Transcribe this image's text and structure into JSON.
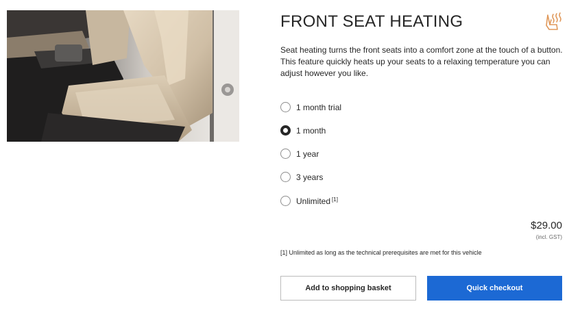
{
  "product": {
    "title": "FRONT SEAT HEATING",
    "icon": "seat-heating-icon",
    "image": "car-front-seat-photo",
    "description": "Seat heating turns the front seats into a comfort zone at the touch of a button. This feature quickly heats up your seats to a relaxing temperature you can adjust however you like."
  },
  "options": [
    {
      "label": "1 month trial",
      "selected": false,
      "note": ""
    },
    {
      "label": "1 month",
      "selected": true,
      "note": ""
    },
    {
      "label": "1 year",
      "selected": false,
      "note": ""
    },
    {
      "label": "3 years",
      "selected": false,
      "note": ""
    },
    {
      "label": "Unlimited",
      "selected": false,
      "note": "[1]"
    }
  ],
  "price": {
    "amount": "$29.00",
    "tax_note": "(incl. GST)"
  },
  "footnote": "[1] Unlimited as long as the technical prerequisites are met for this vehicle",
  "actions": {
    "basket_label": "Add to shopping basket",
    "checkout_label": "Quick checkout"
  },
  "colors": {
    "accent": "#1c69d4",
    "icon": "#e0985a",
    "text": "#262626"
  }
}
